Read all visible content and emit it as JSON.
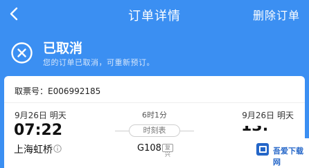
{
  "header": {
    "title": "订单详情",
    "delete_label": "删除订单"
  },
  "status": {
    "title": "已取消",
    "description": "您的订单已取消，可重新预订。"
  },
  "ticket": {
    "ticket_number": "取票号：E006992185",
    "departure": {
      "date": "9月26日  明天",
      "time": "07:22",
      "station": "上海虹桥"
    },
    "arrival": {
      "date": "9月26日  明天",
      "time": "13:33"
    },
    "duration": "6时1分",
    "schedule_label": "时刻表",
    "train_number": "G108",
    "train_tag": "复兴"
  },
  "watermark": {
    "text": "吾爱下载网"
  },
  "colors": {
    "header_bg": "#3b8ff2",
    "card_bg": "#ffffff",
    "accent": "#2466c8"
  }
}
